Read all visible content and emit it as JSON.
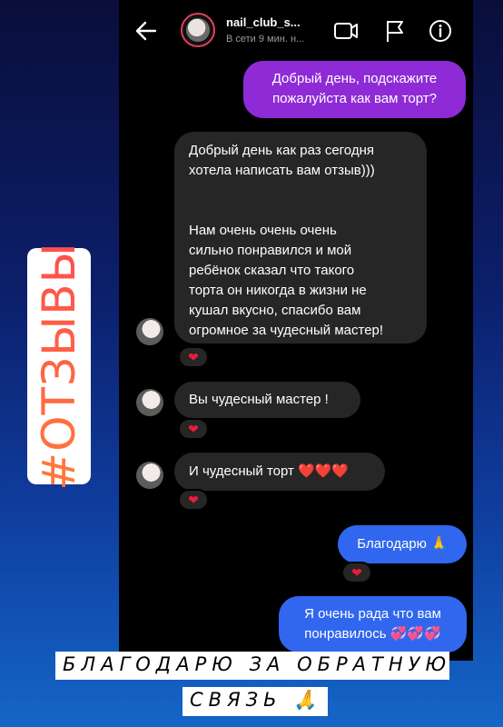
{
  "story": {
    "tag": "#ОТЗЫВЫ",
    "caption_line1": "БЛАГОДАРЮ ЗА ОБРАТНУЮ",
    "caption_line2": "СВЯЗЬ 🙏"
  },
  "header": {
    "username": "nail_club_s...",
    "status": "В сети 9 мин. н...",
    "icons": [
      "back-arrow-icon",
      "video-call-icon",
      "flag-icon",
      "info-icon"
    ]
  },
  "messages": [
    {
      "side": "outgoing",
      "text": "Добрый день, подскажите\nпожалуйста как вам торт?"
    },
    {
      "side": "incoming",
      "text": "Добрый день как раз  сегодня\nхотела написать вам отзыв)))\n\n\nНам очень очень очень\nсильно понравился и мой\nребёнок сказал что такого\nторта он никогда в жизни не\nкушал вкусно, спасибо вам\nогромное за чудесный мастер!",
      "reaction": "❤"
    },
    {
      "side": "incoming",
      "text": "Вы чудесный мастер !",
      "reaction": "❤"
    },
    {
      "side": "incoming",
      "text": "И чудесный торт ❤️❤️❤️",
      "reaction": "❤"
    },
    {
      "side": "outgoing",
      "text": "Благодарю 🙏",
      "reaction": "❤"
    },
    {
      "side": "outgoing",
      "text": "Я очень рада что вам\nпонравилось 💞💞💞"
    }
  ],
  "colors": {
    "outgoing_purple": "#8e2bd6",
    "outgoing_blue": "#3167ee",
    "incoming": "#262626",
    "heart": "#ed1c3a",
    "tag_gradient_start": "#ff7a3a",
    "tag_gradient_end": "#ff4d4d"
  }
}
